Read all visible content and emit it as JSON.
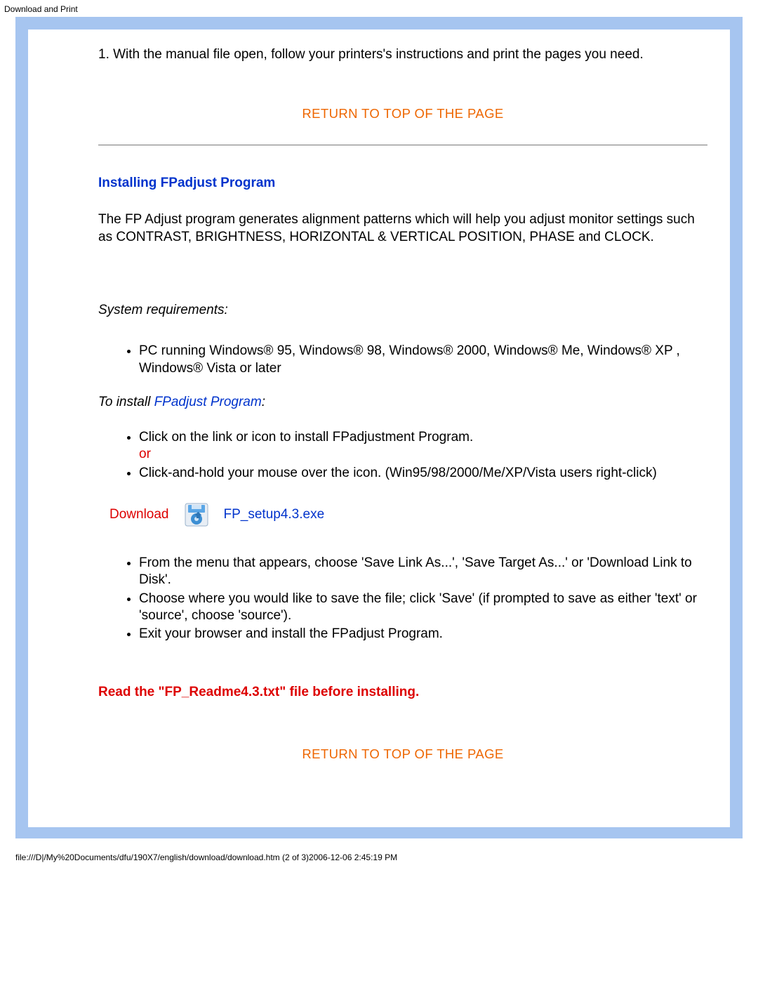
{
  "header": {
    "title": "Download and Print"
  },
  "content": {
    "step1": "1. With the manual file open, follow your printers's instructions and print the pages you need.",
    "return_link": "RETURN TO TOP OF THE PAGE",
    "section_heading": "Installing FPadjust Program",
    "intro_para": "The FP Adjust program generates alignment patterns which will help you adjust monitor settings such as CONTRAST, BRIGHTNESS, HORIZONTAL & VERTICAL POSITION, PHASE and CLOCK.",
    "sysreq_heading": "System requirements:",
    "sysreq_item": "PC running Windows® 95, Windows® 98, Windows® 2000, Windows® Me, Windows® XP , Windows® Vista or later",
    "to_install_prefix": "To install ",
    "to_install_link": "FPadjust Program",
    "to_install_suffix": ":",
    "install_step1": "Click on the link or icon to install FPadjustment Program.",
    "or_text": "or",
    "install_step2": "Click-and-hold your mouse over the icon. (Win95/98/2000/Me/XP/Vista users right-click)",
    "download_label": "Download",
    "download_file": "FP_setup4.3.exe",
    "after_dl_1": "From the menu that appears, choose 'Save Link As...', 'Save Target As...' or 'Download Link to Disk'.",
    "after_dl_2": "Choose where you would like to save the file; click 'Save' (if prompted to save as either 'text' or 'source', choose 'source').",
    "after_dl_3": "Exit your browser and install the FPadjust Program.",
    "readme_note": "Read the \"FP_Readme4.3.txt\" file before installing."
  },
  "footer": {
    "path": "file:///D|/My%20Documents/dfu/190X7/english/download/download.htm (2 of 3)2006-12-06 2:45:19 PM"
  }
}
